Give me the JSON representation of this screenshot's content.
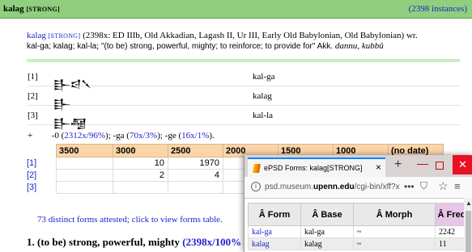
{
  "header": {
    "lemma": "kalag",
    "pos": "[STRONG]",
    "instances": "(2398 instances)"
  },
  "summary": {
    "lemma": "kalag",
    "pos": "[STRONG]",
    "attestation": "(2398x: ED IIIb, Old Akkadian, Lagash II, Ur III, Early Old Babylonian, Old Babylonian) wr.",
    "forms": "kal-ga; kalag; kal-la",
    "gloss": "\"(to be) strong, powerful, mighty; to reinforce; to provide for\" Akk.",
    "akkadian": "dannu, kubbû"
  },
  "form_rows": [
    {
      "index": "[1]",
      "sign": "𒃲𒁀𒃵",
      "value": "kal-ga"
    },
    {
      "index": "[2]",
      "sign": "𒃲",
      "value": "kalag"
    },
    {
      "index": "[3]",
      "sign": "𒃲𒆷",
      "value": "kal-la"
    }
  ],
  "stats": {
    "plus": "+",
    "lead": "-0 (",
    "p1": "2312x/96%",
    "m1": "); -ga (",
    "p2": "70x/3%",
    "m2": "); -ge (",
    "p3": "16x/1%",
    "tail": ")."
  },
  "period_table": {
    "headers": [
      "3500",
      "3000",
      "2500",
      "2000",
      "1500",
      "1000",
      "(no date)"
    ],
    "rows": [
      {
        "label": "[1]",
        "cells": [
          "",
          "10",
          "1970",
          "",
          "",
          "",
          ""
        ]
      },
      {
        "label": "[2]",
        "cells": [
          "",
          "2",
          "4",
          "",
          "",
          "",
          ""
        ]
      },
      {
        "label": "[3]",
        "cells": [
          "",
          "",
          "",
          "",
          "",
          "",
          ""
        ]
      }
    ]
  },
  "forms_link": "73 distinct forms attested; click to view forms table.",
  "sense": {
    "text": "1. (to be) strong, powerful, mighty",
    "count": "(2398x/100%"
  },
  "popup": {
    "tab_title": "ePSD Forms: kalag[STRONG]",
    "tab_close": "×",
    "new_tab": "+",
    "url_prefix": "psd.museum.",
    "url_domain": "upenn.edu",
    "url_rest": "/cgi-bin/xff?x",
    "more": "•••",
    "columns": [
      "Â Form",
      "Â Base",
      "Â Morph",
      "Â Freq"
    ],
    "rows": [
      {
        "form": "kal-ga",
        "base": "kal-ga",
        "morph": "~",
        "freq": "2242"
      },
      {
        "form": "kalag",
        "base": "kalag",
        "morph": "~",
        "freq": "11"
      }
    ]
  }
}
